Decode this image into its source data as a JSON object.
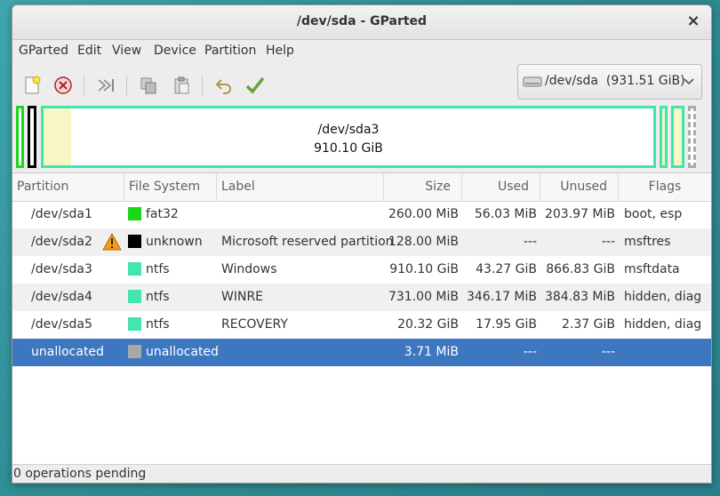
{
  "window": {
    "title": "/dev/sda - GParted",
    "close": "×"
  },
  "menu": [
    "GParted",
    "Edit",
    "View",
    "Device",
    "Partition",
    "Help"
  ],
  "toolbar": {
    "buttons": [
      "new-icon",
      "delete-icon",
      "resize-move-icon",
      "copy-icon",
      "paste-icon",
      "undo-icon",
      "apply-icon"
    ]
  },
  "device": {
    "label": "/dev/sda  (931.51 GiB)",
    "icon": "hard-disk-icon"
  },
  "diskmap": {
    "main_name": "/dev/sda3",
    "main_size": "910.10 GiB"
  },
  "colors": {
    "fat32": "#18d818",
    "unknown": "#000000",
    "ntfs": "#42e5ac",
    "unallocated": "#a9a9a9",
    "selection": "#3d77c0"
  },
  "table": {
    "headers": {
      "partition": "Partition",
      "filesystem": "File System",
      "label": "Label",
      "size": "Size",
      "used": "Used",
      "unused": "Unused",
      "flags": "Flags"
    },
    "rows": [
      {
        "partition": "/dev/sda1",
        "filesystem": "fat32",
        "label": "",
        "size": "260.00 MiB",
        "used": "56.03 MiB",
        "unused": "203.97 MiB",
        "flags": "boot, esp"
      },
      {
        "partition": "/dev/sda2",
        "filesystem": "unknown",
        "label": "Microsoft reserved partition",
        "size": "128.00 MiB",
        "used": "---",
        "unused": "---",
        "flags": "msftres",
        "warning": true
      },
      {
        "partition": "/dev/sda3",
        "filesystem": "ntfs",
        "label": "Windows",
        "size": "910.10 GiB",
        "used": "43.27 GiB",
        "unused": "866.83 GiB",
        "flags": "msftdata"
      },
      {
        "partition": "/dev/sda4",
        "filesystem": "ntfs",
        "label": "WINRE",
        "size": "731.00 MiB",
        "used": "346.17 MiB",
        "unused": "384.83 MiB",
        "flags": "hidden, diag"
      },
      {
        "partition": "/dev/sda5",
        "filesystem": "ntfs",
        "label": "RECOVERY",
        "size": "20.32 GiB",
        "used": "17.95 GiB",
        "unused": "2.37 GiB",
        "flags": "hidden, diag"
      },
      {
        "partition": "unallocated",
        "filesystem": "unallocated",
        "label": "",
        "size": "3.71 MiB",
        "used": "---",
        "unused": "---",
        "flags": "",
        "selected": true
      }
    ]
  },
  "status": "0 operations pending"
}
